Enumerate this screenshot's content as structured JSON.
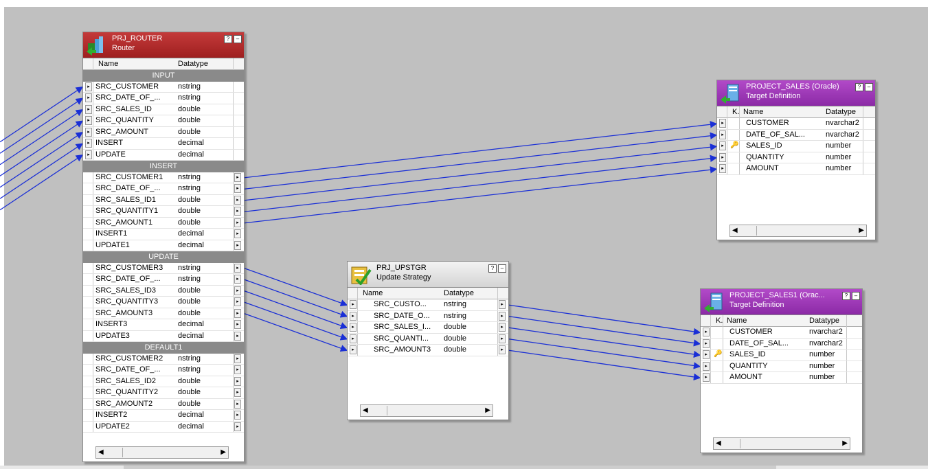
{
  "router": {
    "name": "PRJ_ROUTER",
    "type": "Router",
    "col_name": "Name",
    "col_type": "Datatype",
    "groups": [
      {
        "label": "INPUT",
        "rows": [
          {
            "name": "SRC_CUSTOMER",
            "type": "nstring"
          },
          {
            "name": "SRC_DATE_OF_...",
            "type": "nstring"
          },
          {
            "name": "SRC_SALES_ID",
            "type": "double"
          },
          {
            "name": "SRC_QUANTITY",
            "type": "double"
          },
          {
            "name": "SRC_AMOUNT",
            "type": "double"
          },
          {
            "name": "INSERT",
            "type": "decimal"
          },
          {
            "name": "UPDATE",
            "type": "decimal"
          }
        ]
      },
      {
        "label": "INSERT",
        "rows": [
          {
            "name": "SRC_CUSTOMER1",
            "type": "nstring"
          },
          {
            "name": "SRC_DATE_OF_...",
            "type": "nstring"
          },
          {
            "name": "SRC_SALES_ID1",
            "type": "double"
          },
          {
            "name": "SRC_QUANTITY1",
            "type": "double"
          },
          {
            "name": "SRC_AMOUNT1",
            "type": "double"
          },
          {
            "name": "INSERT1",
            "type": "decimal"
          },
          {
            "name": "UPDATE1",
            "type": "decimal"
          }
        ]
      },
      {
        "label": "UPDATE",
        "rows": [
          {
            "name": "SRC_CUSTOMER3",
            "type": "nstring"
          },
          {
            "name": "SRC_DATE_OF_...",
            "type": "nstring"
          },
          {
            "name": "SRC_SALES_ID3",
            "type": "double"
          },
          {
            "name": "SRC_QUANTITY3",
            "type": "double"
          },
          {
            "name": "SRC_AMOUNT3",
            "type": "double"
          },
          {
            "name": "INSERT3",
            "type": "decimal"
          },
          {
            "name": "UPDATE3",
            "type": "decimal"
          }
        ]
      },
      {
        "label": "DEFAULT1",
        "rows": [
          {
            "name": "SRC_CUSTOMER2",
            "type": "nstring"
          },
          {
            "name": "SRC_DATE_OF_...",
            "type": "nstring"
          },
          {
            "name": "SRC_SALES_ID2",
            "type": "double"
          },
          {
            "name": "SRC_QUANTITY2",
            "type": "double"
          },
          {
            "name": "SRC_AMOUNT2",
            "type": "double"
          },
          {
            "name": "INSERT2",
            "type": "decimal"
          },
          {
            "name": "UPDATE2",
            "type": "decimal"
          }
        ]
      }
    ]
  },
  "upd": {
    "name": "PRJ_UPSTGR",
    "type": "Update Strategy",
    "col_name": "Name",
    "col_type": "Datatype",
    "rows": [
      {
        "name": "SRC_CUSTO...",
        "type": "nstring"
      },
      {
        "name": "SRC_DATE_O...",
        "type": "nstring"
      },
      {
        "name": "SRC_SALES_I...",
        "type": "double"
      },
      {
        "name": "SRC_QUANTI...",
        "type": "double"
      },
      {
        "name": "SRC_AMOUNT3",
        "type": "double"
      }
    ]
  },
  "target1": {
    "name": "PROJECT_SALES (Oracle)",
    "type": "Target Definition",
    "col_key": "K.",
    "col_name": "Name",
    "col_type": "Datatype",
    "rows": [
      {
        "name": "CUSTOMER",
        "type": "nvarchar2",
        "key": false
      },
      {
        "name": "DATE_OF_SAL...",
        "type": "nvarchar2",
        "key": false
      },
      {
        "name": "SALES_ID",
        "type": "number",
        "key": true
      },
      {
        "name": "QUANTITY",
        "type": "number",
        "key": false
      },
      {
        "name": "AMOUNT",
        "type": "number",
        "key": false
      }
    ]
  },
  "target2": {
    "name": "PROJECT_SALES1 (Orac...",
    "type": "Target Definition",
    "col_key": "K.",
    "col_name": "Name",
    "col_type": "Datatype",
    "rows": [
      {
        "name": "CUSTOMER",
        "type": "nvarchar2",
        "key": false
      },
      {
        "name": "DATE_OF_SAL...",
        "type": "nvarchar2",
        "key": false
      },
      {
        "name": "SALES_ID",
        "type": "number",
        "key": true
      },
      {
        "name": "QUANTITY",
        "type": "number",
        "key": false
      },
      {
        "name": "AMOUNT",
        "type": "number",
        "key": false
      }
    ]
  },
  "ui": {
    "help_glyph": "?",
    "min_glyph": "–",
    "port_glyph": "▸",
    "key_glyph": "🔑",
    "scroll_left": "◀",
    "scroll_right": "▶"
  },
  "colors": {
    "canvas": "#c0c0c0",
    "link": "#1a2fd6",
    "router_header": "#b02a2a",
    "target_header": "#9b37b8"
  }
}
